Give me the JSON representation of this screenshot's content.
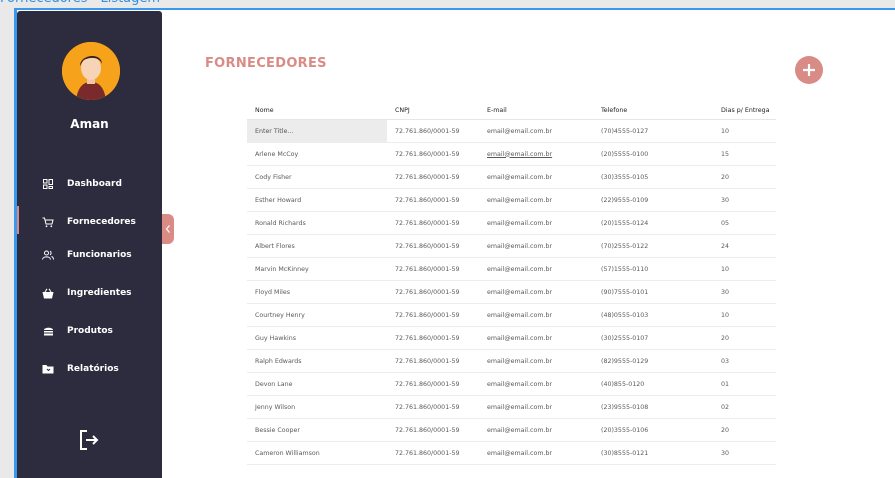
{
  "window": {
    "title": "Fornecedores - Listagem"
  },
  "sidebar": {
    "user_name": "Aman",
    "items": [
      {
        "label": "Dashboard",
        "icon": "dashboard-icon"
      },
      {
        "label": "Fornecedores",
        "icon": "cart-icon",
        "active": true
      },
      {
        "label": "Funcionarios",
        "icon": "users-icon"
      },
      {
        "label": "Ingredientes",
        "icon": "basket-icon"
      },
      {
        "label": "Produtos",
        "icon": "cake-icon"
      },
      {
        "label": "Relatórios",
        "icon": "folder-icon"
      }
    ],
    "logout_icon": "logout-icon"
  },
  "main": {
    "title": "FORNECEDORES",
    "add_icon": "plus-icon",
    "columns": [
      "Nome",
      "CNPJ",
      "E-mail",
      "Telefone",
      "Dias p/ Entrega"
    ],
    "first_row": {
      "name_placeholder": "Enter Title...",
      "cnpj": "72.761.860/0001-59",
      "email": "email@email.com.br",
      "phone": "(70)4555-0127",
      "days": "10"
    },
    "rows": [
      [
        "Arlene McCoy",
        "72.761.860/0001-59",
        "email@email.com.br",
        "(20)5555-0100",
        "15"
      ],
      [
        "Cody Fisher",
        "72.761.860/0001-59",
        "email@email.com.br",
        "(30)3555-0105",
        "20"
      ],
      [
        "Esther Howard",
        "72.761.860/0001-59",
        "email@email.com.br",
        "(22)9555-0109",
        "30"
      ],
      [
        "Ronald Richards",
        "72.761.860/0001-59",
        "email@email.com.br",
        "(20)1555-0124",
        "05"
      ],
      [
        "Albert Flores",
        "72.761.860/0001-59",
        "email@email.com.br",
        "(70)2555-0122",
        "24"
      ],
      [
        "Marvin McKinney",
        "72.761.860/0001-59",
        "email@email.com.br",
        "(57)1555-0110",
        "10"
      ],
      [
        "Floyd Miles",
        "72.761.860/0001-59",
        "email@email.com.br",
        "(90)7555-0101",
        "30"
      ],
      [
        "Courtney Henry",
        "72.761.860/0001-59",
        "email@email.com.br",
        "(48)0555-0103",
        "10"
      ],
      [
        "Guy Hawkins",
        "72.761.860/0001-59",
        "email@email.com.br",
        "(30)2555-0107",
        "20"
      ],
      [
        "Ralph Edwards",
        "72.761.860/0001-59",
        "email@email.com.br",
        "(82)9555-0129",
        "03"
      ],
      [
        "Devon Lane",
        "72.761.860/0001-59",
        "email@email.com.br",
        "(40)855-0120",
        "01"
      ],
      [
        "Jenny Wilson",
        "72.761.860/0001-59",
        "email@email.com.br",
        "(23)9555-0108",
        "02"
      ],
      [
        "Bessie Cooper",
        "72.761.860/0001-59",
        "email@email.com.br",
        "(20)3555-0106",
        "20"
      ],
      [
        "Cameron Williamson",
        "72.761.860/0001-59",
        "email@email.com.br",
        "(30)8555-0121",
        "30"
      ]
    ]
  },
  "colors": {
    "accent": "#d98b86",
    "sidebar": "#2d2c3e",
    "frame": "#3a97ee",
    "avatar_bg": "#f6a21b"
  }
}
